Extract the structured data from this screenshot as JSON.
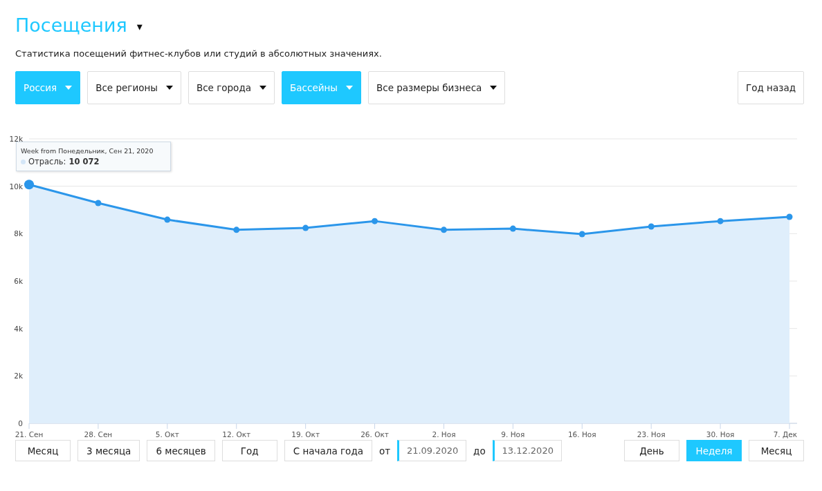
{
  "header": {
    "title": "Посещения",
    "caret": "▾",
    "subtitle": "Статистика посещений фитнес-клубов или студий в абсолютных значениях."
  },
  "filters": [
    {
      "label": "Россия",
      "active": true
    },
    {
      "label": "Все регионы",
      "active": false
    },
    {
      "label": "Все города",
      "active": false
    },
    {
      "label": "Бассейны",
      "active": true
    },
    {
      "label": "Все размеры бизнеса",
      "active": false
    }
  ],
  "compare_button": "Год назад",
  "chart": {
    "chart_data": {
      "type": "area",
      "categories": [
        "21. Сен",
        "28. Сен",
        "5. Окт",
        "12. Окт",
        "19. Окт",
        "26. Окт",
        "2. Ноя",
        "9. Ноя",
        "16. Ноя",
        "23. Ноя",
        "30. Ноя",
        "7. Дек"
      ],
      "series": [
        {
          "name": "Отрасль",
          "color": "#2b96ea",
          "values": [
            10070,
            9290,
            8590,
            8160,
            8240,
            8530,
            8160,
            8210,
            7980,
            8300,
            8530,
            8710
          ]
        }
      ],
      "ylim": [
        0,
        12000
      ],
      "grid": true,
      "yticks": [
        {
          "value": 0,
          "label": "0"
        },
        {
          "value": 2000,
          "label": "2k"
        },
        {
          "value": 4000,
          "label": "4k"
        },
        {
          "value": 6000,
          "label": "6k"
        },
        {
          "value": 8000,
          "label": "8k"
        },
        {
          "value": 10000,
          "label": "10k"
        },
        {
          "value": 12000,
          "label": "12k"
        }
      ]
    },
    "tooltip": {
      "title": "Week from Понедельник, Сен 21, 2020",
      "separator": ":",
      "value": "10 072"
    }
  },
  "ranges": [
    {
      "label": "Месяц",
      "selected": false
    },
    {
      "label": "3 месяца",
      "selected": false
    },
    {
      "label": "6 месяцев",
      "selected": false
    },
    {
      "label": "Год",
      "selected": false
    },
    {
      "label": "С начала года",
      "selected": false
    }
  ],
  "date_from": {
    "label": "от",
    "value": "21.09.2020"
  },
  "date_to": {
    "label": "до",
    "value": "13.12.2020"
  },
  "granularity": [
    {
      "label": "День",
      "selected": false
    },
    {
      "label": "Неделя",
      "selected": true
    },
    {
      "label": "Месяц",
      "selected": false
    }
  ]
}
